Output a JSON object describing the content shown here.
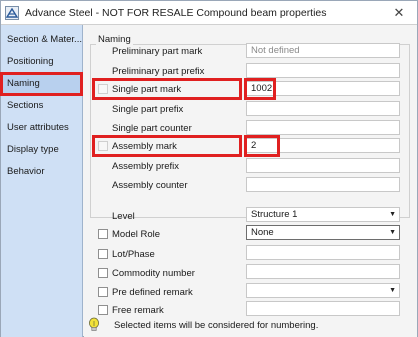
{
  "window": {
    "title": "Advance Steel - NOT FOR RESALE  Compound beam properties",
    "close_glyph": "✕"
  },
  "sidebar": {
    "items": [
      {
        "label": "Section & Mater..."
      },
      {
        "label": "Positioning"
      },
      {
        "label": "Naming"
      },
      {
        "label": "Sections"
      },
      {
        "label": "User attributes"
      },
      {
        "label": "Display type"
      },
      {
        "label": "Behavior"
      }
    ],
    "active_index": 2
  },
  "naming": {
    "group_label": "Naming",
    "rows": [
      {
        "label": "Preliminary part mark",
        "value": "",
        "placeholder": "Not defined"
      },
      {
        "label": "Preliminary part prefix",
        "value": ""
      },
      {
        "label": "Single part mark",
        "value": "1002"
      },
      {
        "label": "Single part prefix",
        "value": ""
      },
      {
        "label": "Single part counter",
        "value": ""
      },
      {
        "label": "Assembly mark",
        "value": "2"
      },
      {
        "label": "Assembly prefix",
        "value": ""
      },
      {
        "label": "Assembly counter",
        "value": ""
      }
    ]
  },
  "properties": {
    "rows": [
      {
        "label": "Level",
        "value": "Structure 1",
        "type": "dropdown"
      },
      {
        "label": "Model Role",
        "value": "None",
        "type": "dropdown"
      },
      {
        "label": "Lot/Phase",
        "value": "",
        "type": "text"
      },
      {
        "label": "Commodity number",
        "value": "",
        "type": "text"
      },
      {
        "label": "Pre defined remark",
        "value": "",
        "type": "dropdown"
      },
      {
        "label": "Free remark",
        "value": "",
        "type": "text"
      }
    ]
  },
  "info": {
    "text": "Selected items will be considered for numbering."
  },
  "colors": {
    "sidebar_bg": "#cfe0f5",
    "highlight": "#e02020",
    "active_item": "#b8d0ee"
  },
  "icons": {
    "app": "advance-steel-icon",
    "info": "lightbulb-icon",
    "dropdown": "chevron-down-icon"
  }
}
